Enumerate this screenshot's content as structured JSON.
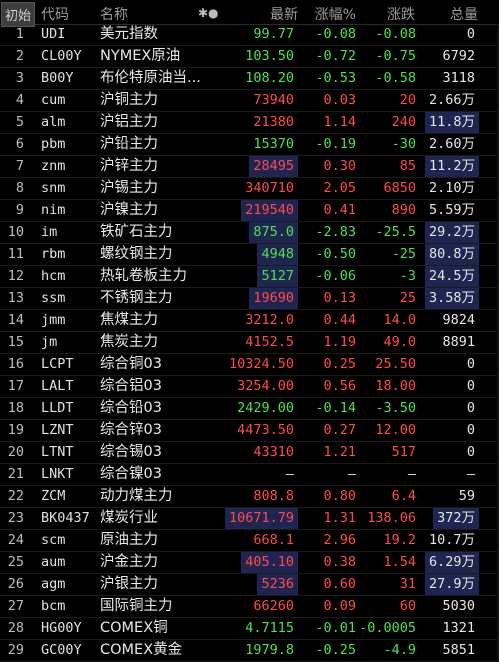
{
  "header": {
    "init_tab": "初始",
    "col_code": "代码",
    "col_name": "名称",
    "col_indicator": "✱●",
    "col_price": "最新",
    "col_pct": "涨幅%",
    "col_chg": "涨跌",
    "col_vol": "总量"
  },
  "colors": {
    "up": "#ff4a4a",
    "down": "#4ee04e",
    "highlight": "#1d2550",
    "background": "#000000"
  },
  "rows": [
    {
      "idx": "1",
      "code": "UDI",
      "name": "美元指数",
      "price": "99.77",
      "pct": "-0.08",
      "chg": "-0.08",
      "vol": "0",
      "dir": "dn",
      "ph": false,
      "vh": false
    },
    {
      "idx": "2",
      "code": "CL00Y",
      "name": "NYMEX原油",
      "price": "103.50",
      "pct": "-0.72",
      "chg": "-0.75",
      "vol": "6792",
      "dir": "dn",
      "ph": false,
      "vh": false
    },
    {
      "idx": "3",
      "code": "B00Y",
      "name": "布伦特原油当...",
      "price": "108.20",
      "pct": "-0.53",
      "chg": "-0.58",
      "vol": "3118",
      "dir": "dn",
      "ph": false,
      "vh": false
    },
    {
      "idx": "4",
      "code": "cum",
      "name": "沪铜主力",
      "price": "73940",
      "pct": "0.03",
      "chg": "20",
      "vol": "2.66万",
      "dir": "up",
      "ph": false,
      "vh": false
    },
    {
      "idx": "5",
      "code": "alm",
      "name": "沪铝主力",
      "price": "21380",
      "pct": "1.14",
      "chg": "240",
      "vol": "11.8万",
      "dir": "up",
      "ph": false,
      "vh": true
    },
    {
      "idx": "6",
      "code": "pbm",
      "name": "沪铅主力",
      "price": "15370",
      "pct": "-0.19",
      "chg": "-30",
      "vol": "2.60万",
      "dir": "dn",
      "ph": false,
      "vh": false
    },
    {
      "idx": "7",
      "code": "znm",
      "name": "沪锌主力",
      "price": "28495",
      "pct": "0.30",
      "chg": "85",
      "vol": "11.2万",
      "dir": "up",
      "ph": true,
      "vh": true
    },
    {
      "idx": "8",
      "code": "snm",
      "name": "沪锡主力",
      "price": "340710",
      "pct": "2.05",
      "chg": "6850",
      "vol": "2.10万",
      "dir": "up",
      "ph": false,
      "vh": false
    },
    {
      "idx": "9",
      "code": "nim",
      "name": "沪镍主力",
      "price": "219540",
      "pct": "0.41",
      "chg": "890",
      "vol": "5.59万",
      "dir": "up",
      "ph": true,
      "vh": false
    },
    {
      "idx": "10",
      "code": "im",
      "name": "铁矿石主力",
      "price": "875.0",
      "pct": "-2.83",
      "chg": "-25.5",
      "vol": "29.2万",
      "dir": "dn",
      "ph": true,
      "vh": true
    },
    {
      "idx": "11",
      "code": "rbm",
      "name": "螺纹钢主力",
      "price": "4948",
      "pct": "-0.50",
      "chg": "-25",
      "vol": "80.8万",
      "dir": "dn",
      "ph": true,
      "vh": true
    },
    {
      "idx": "12",
      "code": "hcm",
      "name": "热轧卷板主力",
      "price": "5127",
      "pct": "-0.06",
      "chg": "-3",
      "vol": "24.5万",
      "dir": "dn",
      "ph": true,
      "vh": true
    },
    {
      "idx": "13",
      "code": "ssm",
      "name": "不锈钢主力",
      "price": "19690",
      "pct": "0.13",
      "chg": "25",
      "vol": "3.58万",
      "dir": "up",
      "ph": true,
      "vh": true
    },
    {
      "idx": "14",
      "code": "jmm",
      "name": "焦煤主力",
      "price": "3212.0",
      "pct": "0.44",
      "chg": "14.0",
      "vol": "9824",
      "dir": "up",
      "ph": false,
      "vh": false
    },
    {
      "idx": "15",
      "code": "jm",
      "name": "焦炭主力",
      "price": "4152.5",
      "pct": "1.19",
      "chg": "49.0",
      "vol": "8891",
      "dir": "up",
      "ph": false,
      "vh": false
    },
    {
      "idx": "16",
      "code": "LCPT",
      "name": "综合铜03",
      "price": "10324.50",
      "pct": "0.25",
      "chg": "25.50",
      "vol": "0",
      "dir": "up",
      "ph": false,
      "vh": false
    },
    {
      "idx": "17",
      "code": "LALT",
      "name": "综合铝03",
      "price": "3254.00",
      "pct": "0.56",
      "chg": "18.00",
      "vol": "0",
      "dir": "up",
      "ph": false,
      "vh": false
    },
    {
      "idx": "18",
      "code": "LLDT",
      "name": "综合铅03",
      "price": "2429.00",
      "pct": "-0.14",
      "chg": "-3.50",
      "vol": "0",
      "dir": "dn",
      "ph": false,
      "vh": false
    },
    {
      "idx": "19",
      "code": "LZNT",
      "name": "综合锌03",
      "price": "4473.50",
      "pct": "0.27",
      "chg": "12.00",
      "vol": "0",
      "dir": "up",
      "ph": false,
      "vh": false
    },
    {
      "idx": "20",
      "code": "LTNT",
      "name": "综合锡03",
      "price": "43310",
      "pct": "1.21",
      "chg": "517",
      "vol": "0",
      "dir": "up",
      "ph": false,
      "vh": false
    },
    {
      "idx": "21",
      "code": "LNKT",
      "name": "综合镍03",
      "price": "—",
      "pct": "—",
      "chg": "—",
      "vol": "—",
      "dir": "nt",
      "ph": false,
      "vh": false
    },
    {
      "idx": "22",
      "code": "ZCM",
      "name": "动力煤主力",
      "price": "808.8",
      "pct": "0.80",
      "chg": "6.4",
      "vol": "59",
      "dir": "up",
      "ph": false,
      "vh": false
    },
    {
      "idx": "23",
      "code": "BK0437",
      "name": "煤炭行业",
      "price": "10671.79",
      "pct": "1.31",
      "chg": "138.06",
      "vol": "372万",
      "dir": "up",
      "ph": true,
      "vh": true
    },
    {
      "idx": "24",
      "code": "scm",
      "name": "原油主力",
      "price": "668.1",
      "pct": "2.96",
      "chg": "19.2",
      "vol": "10.7万",
      "dir": "up",
      "ph": false,
      "vh": false
    },
    {
      "idx": "25",
      "code": "aum",
      "name": "沪金主力",
      "price": "405.10",
      "pct": "0.38",
      "chg": "1.54",
      "vol": "6.29万",
      "dir": "up",
      "ph": true,
      "vh": true
    },
    {
      "idx": "26",
      "code": "agm",
      "name": "沪银主力",
      "price": "5236",
      "pct": "0.60",
      "chg": "31",
      "vol": "27.9万",
      "dir": "up",
      "ph": true,
      "vh": true
    },
    {
      "idx": "27",
      "code": "bcm",
      "name": "国际铜主力",
      "price": "66260",
      "pct": "0.09",
      "chg": "60",
      "vol": "5030",
      "dir": "up",
      "ph": false,
      "vh": false
    },
    {
      "idx": "28",
      "code": "HG00Y",
      "name": "COMEX铜",
      "price": "4.7115",
      "pct": "-0.01",
      "chg": "-0.0005",
      "vol": "1321",
      "dir": "dn",
      "ph": false,
      "vh": false
    },
    {
      "idx": "29",
      "code": "GC00Y",
      "name": "COMEX黄金",
      "price": "1979.8",
      "pct": "-0.25",
      "chg": "-4.9",
      "vol": "5851",
      "dir": "dn",
      "ph": false,
      "vh": false
    }
  ]
}
